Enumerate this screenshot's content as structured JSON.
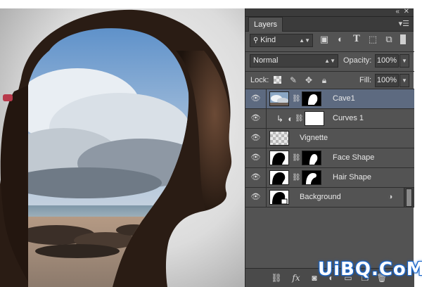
{
  "panel": {
    "tab_label": "Layers",
    "filter_kind": "Kind",
    "blend_mode": "Normal",
    "opacity_label": "Opacity:",
    "opacity_value": "100%",
    "lock_label": "Lock:",
    "fill_label": "Fill:",
    "fill_value": "100%"
  },
  "layers": [
    {
      "name": "Cave1",
      "selected": true,
      "has_mask": true,
      "thumb": "cloud-thumb",
      "mask": "head-mask"
    },
    {
      "name": "Curves 1",
      "selected": false,
      "has_mask": true,
      "thumb": "curves-adjustment",
      "mask": "white-mask",
      "clipped": true
    },
    {
      "name": "Vignette",
      "selected": false,
      "has_mask": false,
      "thumb": "transparent-thumb"
    },
    {
      "name": "Face Shape",
      "selected": false,
      "has_mask": true,
      "thumb": "silhouette-thumb",
      "mask": "face-mask"
    },
    {
      "name": "Hair Shape",
      "selected": false,
      "has_mask": true,
      "thumb": "silhouette-thumb",
      "mask": "hair-mask"
    },
    {
      "name": "Background",
      "selected": false,
      "has_mask": false,
      "thumb": "silhouette-thumb",
      "smart_object": true
    }
  ],
  "watermark": "UiBQ.CoM",
  "colors": {
    "panel_bg": "#535353",
    "selected_row": "#5d6a80",
    "watermark_stroke": "#1a66c9"
  }
}
